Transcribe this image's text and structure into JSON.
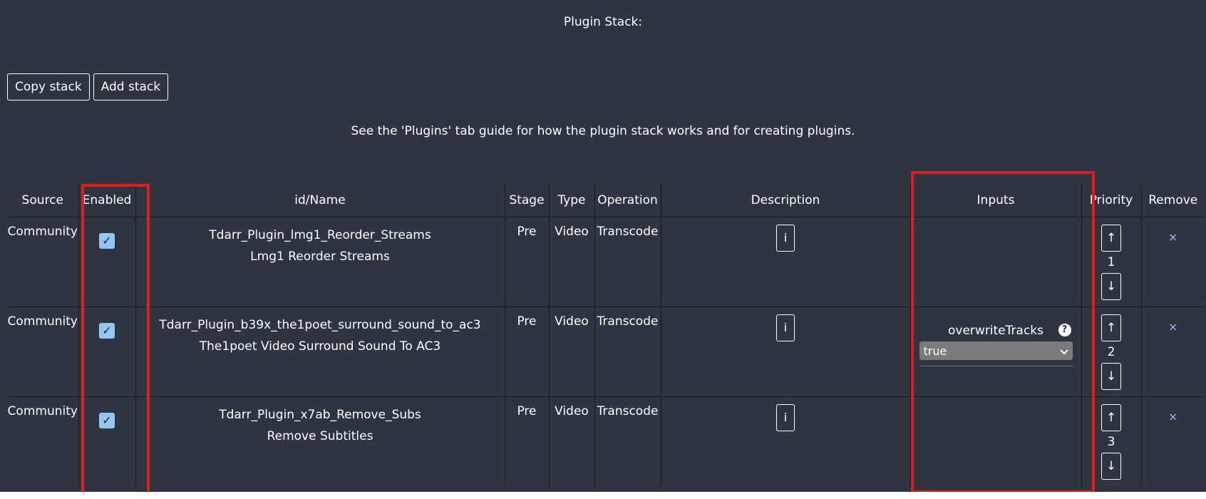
{
  "page": {
    "title": "Plugin Stack:",
    "guide_text": "See the 'Plugins' tab guide for how the plugin stack works and for creating plugins.",
    "highlight_color": "#e11b1b",
    "background_color": "#2f3441"
  },
  "actions": {
    "copy_label": "Copy stack",
    "add_label": "Add stack"
  },
  "table": {
    "headers": {
      "source": "Source",
      "enabled": "Enabled",
      "name": "id/Name",
      "stage": "Stage",
      "type": "Type",
      "operation": "Operation",
      "description": "Description",
      "inputs": "Inputs",
      "priority": "Priority",
      "remove": "Remove"
    },
    "rows": [
      {
        "source": "Community",
        "enabled": true,
        "id": "Tdarr_Plugin_lmg1_Reorder_Streams",
        "name": "Lmg1 Reorder Streams",
        "stage": "Pre",
        "type": "Video",
        "operation": "Transcode",
        "info_label": "i",
        "priority": "1",
        "up_label": "↑",
        "down_label": "↓",
        "remove_label": "×"
      },
      {
        "source": "Community",
        "enabled": true,
        "id": "Tdarr_Plugin_b39x_the1poet_surround_sound_to_ac3",
        "name": "The1poet Video Surround Sound To AC3",
        "stage": "Pre",
        "type": "Video",
        "operation": "Transcode",
        "info_label": "i",
        "input_label": "overwriteTracks",
        "input_value": "true",
        "help_label": "?",
        "priority": "2",
        "up_label": "↑",
        "down_label": "↓",
        "remove_label": "×"
      },
      {
        "source": "Community",
        "enabled": true,
        "id": "Tdarr_Plugin_x7ab_Remove_Subs",
        "name": "Remove Subtitles",
        "stage": "Pre",
        "type": "Video",
        "operation": "Transcode",
        "info_label": "i",
        "priority": "3",
        "up_label": "↑",
        "down_label": "↓",
        "remove_label": "×"
      }
    ]
  },
  "icons": {
    "check": "✓",
    "chevron": "⌄"
  }
}
